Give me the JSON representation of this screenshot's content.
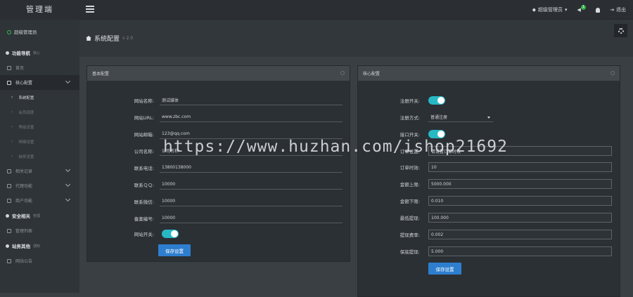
{
  "app": {
    "logo": "管理端"
  },
  "topbar": {
    "admin_label": "超级管理员",
    "notify_count": "1",
    "logout_label": "退出"
  },
  "sidebar": {
    "user": "超级管理员",
    "sections": [
      {
        "title": "功能导航",
        "sub": "核心"
      },
      {
        "title": "安全相关",
        "sub": "管理"
      },
      {
        "title": "站务其他",
        "sub": "通知"
      }
    ],
    "items": {
      "home": "首页",
      "core": "核心配置",
      "core_sub": [
        "系统配置",
        "会员调度",
        "等级设置",
        "明细设置",
        "抽奖设置"
      ],
      "related": "相关记录",
      "agent": "代理功能",
      "merchant": "商户功能",
      "admin_list": "管理列表",
      "site_notice": "网站公告"
    }
  },
  "page": {
    "title": "系统配置",
    "version": "v 2.0"
  },
  "basic": {
    "title": "基本配置",
    "fields": [
      {
        "label": "网站名称:",
        "value": "测试媒体"
      },
      {
        "label": "网站URL:",
        "value": "www.zbc.com"
      },
      {
        "label": "网站邮箱:",
        "value": "123@qq.com"
      },
      {
        "label": "公司名称:",
        "value": "公司名称"
      },
      {
        "label": "联系电话:",
        "value": "13800138000"
      },
      {
        "label": "联系ＱＱ:",
        "value": "10000"
      },
      {
        "label": "联系微信:",
        "value": "10000"
      },
      {
        "label": "备案编号:",
        "value": "10000"
      }
    ],
    "switch_label": "网站开关:",
    "save": "保存设置"
  },
  "core": {
    "title": "核心配置",
    "register_switch": "注册开关:",
    "register_mode_label": "注册方式:",
    "register_mode_value": "普通注册",
    "api_switch": "接口开关:",
    "fields": [
      {
        "label": "订单设置:",
        "value": "请设置订单时效"
      },
      {
        "label": "订单时效:",
        "value": "10"
      },
      {
        "label": "金额上限:",
        "value": "5000.000"
      },
      {
        "label": "金额下限:",
        "value": "0.010"
      },
      {
        "label": "最低提现:",
        "value": "100.000"
      },
      {
        "label": "提现费率:",
        "value": "0.002"
      },
      {
        "label": "保底提现:",
        "value": "5.000"
      }
    ],
    "save": "保存设置"
  },
  "watermark": "https://www.huzhan.com/ishop21692"
}
